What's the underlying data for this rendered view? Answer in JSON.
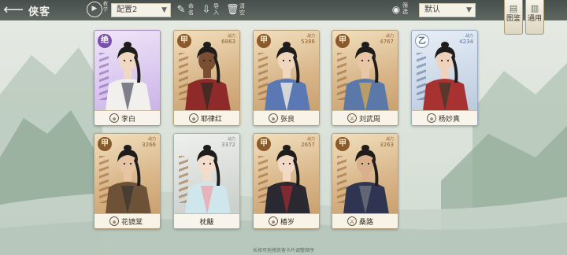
{
  "header": {
    "back_icon": "arrow-left-icon",
    "title": "侠客",
    "play_label": "教学",
    "config_select": "配置2",
    "tools": [
      {
        "icon": "brush-icon",
        "label": "命名"
      },
      {
        "icon": "import-icon",
        "label": "导入"
      },
      {
        "icon": "trash-icon",
        "label": "清空"
      }
    ],
    "filter_label": "筛选",
    "sort_select": "默认"
  },
  "side_buttons": [
    {
      "icon": "book-icon",
      "label": "图鉴"
    },
    {
      "icon": "scroll-icon",
      "label": "通用"
    }
  ],
  "cards": [
    {
      "name": "李白",
      "grade": "绝",
      "tier": "jue",
      "stat_label": "",
      "stat": "",
      "icon": "swirl-icon",
      "robe": "#f2f0ec",
      "accent": "#6b6a7a",
      "skin": "#f1d8c2"
    },
    {
      "name": "耶律红",
      "grade": "甲",
      "tier": "jia",
      "stat_label": "战力",
      "stat": "6863",
      "icon": "swirl-icon",
      "robe": "#8e2a2a",
      "accent": "#3b2a22",
      "skin": "#7a4e33"
    },
    {
      "name": "张良",
      "grade": "甲",
      "tier": "jia",
      "stat_label": "战力",
      "stat": "5386",
      "icon": "swirl-icon",
      "robe": "#5a78b4",
      "accent": "#e9e6de",
      "skin": "#f1d6bf"
    },
    {
      "name": "刘武周",
      "grade": "甲",
      "tier": "jia",
      "stat_label": "战力",
      "stat": "4767",
      "icon": "sword-icon",
      "robe": "#5b79a8",
      "accent": "#c9a35a",
      "skin": "#e8c6a6"
    },
    {
      "name": "杨妙真",
      "grade": "乙",
      "tier": "yi",
      "stat_label": "战力",
      "stat": "4234",
      "icon": "swirl-icon",
      "robe": "#a83232",
      "accent": "#4a3a2a",
      "skin": "#efd2bb"
    },
    {
      "name": "花镜棠",
      "grade": "甲",
      "tier": "jia",
      "stat_label": "战力",
      "stat": "3266",
      "icon": "swirl-icon",
      "robe": "#6e5238",
      "accent": "#3f3a33",
      "skin": "#e6c4a4"
    },
    {
      "name": "枕黻",
      "grade": "",
      "tier": "plain",
      "stat_label": "战力",
      "stat": "3372",
      "icon": "",
      "robe": "#cfe6ec",
      "accent": "#e7a9b4",
      "skin": "#f4dccb"
    },
    {
      "name": "椿岁",
      "grade": "甲",
      "tier": "jia",
      "stat_label": "战力",
      "stat": "2657",
      "icon": "swirl-icon",
      "robe": "#2a2830",
      "accent": "#8e2a34",
      "skin": "#f2d9c6"
    },
    {
      "name": "桑路",
      "grade": "甲",
      "tier": "jia",
      "stat_label": "战力",
      "stat": "3263",
      "icon": "sword-icon",
      "robe": "#2f3550",
      "accent": "#6b6f7a",
      "skin": "#d9b08c"
    }
  ],
  "hint": "长按可拖拽侠客卡片调整顺序",
  "colors": {
    "topbar": "#3f4744",
    "card_gold": "#d7b386",
    "card_blue": "#c9d6e6",
    "card_purple": "#d9c6ee"
  }
}
